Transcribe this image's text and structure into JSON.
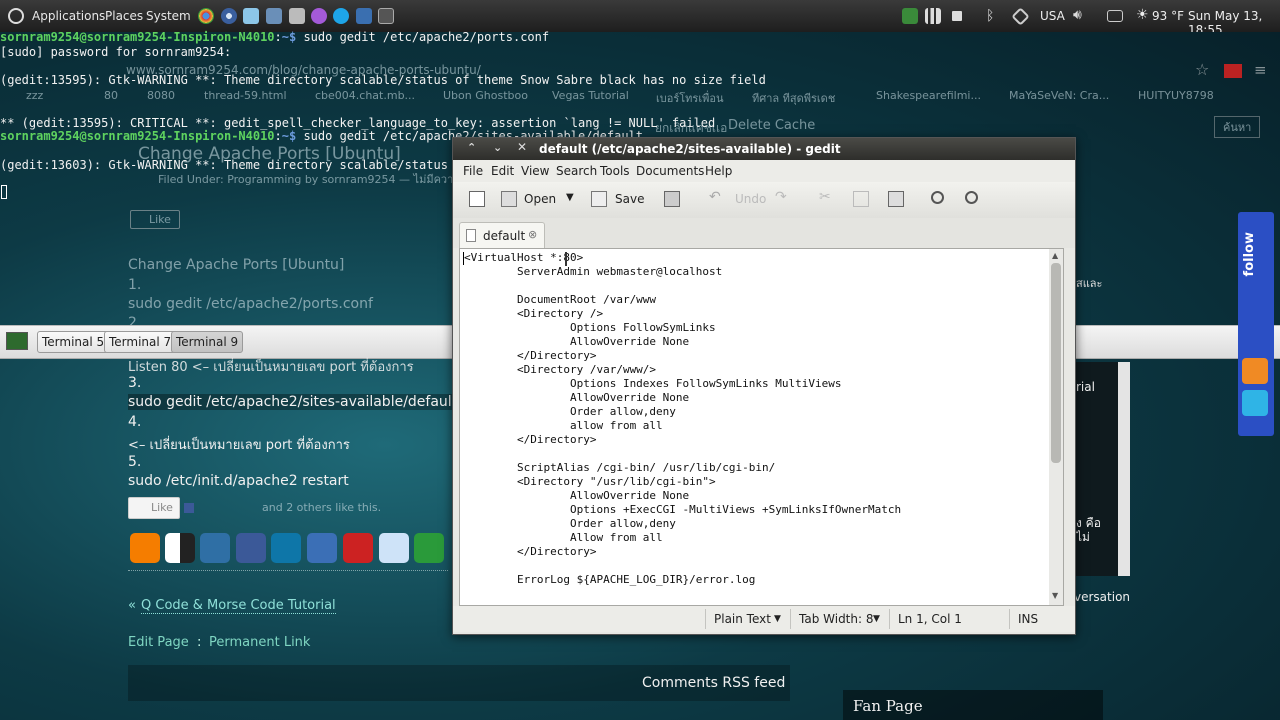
{
  "top_panel": {
    "menus": [
      "Applications",
      "Places",
      "System"
    ],
    "keyboard_layout": "USA",
    "temperature": "93 °F",
    "clock": "Sun May 13, 18:55"
  },
  "terminal": {
    "lines": [
      {
        "user": "sornram9254@sornram9254-Inspiron-N4010",
        "path": "~$",
        "cmd": " sudo gedit /etc/apache2/ports.conf"
      },
      {
        "text": "[sudo] password for sornram9254:"
      },
      {
        "text": ""
      },
      {
        "text": "(gedit:13595): Gtk-WARNING **: Theme directory scalable/status of theme Snow Sabre black has no size field"
      },
      {
        "text": ""
      },
      {
        "text": ""
      },
      {
        "text": "** (gedit:13595): CRITICAL **: gedit_spell_checker_language_to_key: assertion `lang != NULL' failed"
      },
      {
        "user": "sornram9254@sornram9254-Inspiron-N4010",
        "path": "~$",
        "cmd": " sudo gedit /etc/apache2/sites-available/default"
      },
      {
        "text": ""
      },
      {
        "text": "(gedit:13603): Gtk-WARNING **: Theme directory scalable/status of the"
      }
    ]
  },
  "browser_ghost": {
    "url": "www.sornram9254.com/blog/change-apache-ports-ubuntu/",
    "bookmarks": [
      "zzz",
      "80",
      "8080",
      "thread-59.html",
      "cbe004.chat.mb...",
      "Ubon Ghostboo",
      "Vegas Tutorial",
      "เบอร์โทรเพื่อน",
      "ทีศาล ทีสุดพีรเดช",
      "Shakespearefilmi...",
      "MaYaSeVeN: Cra...",
      "HUITYUY8798"
    ],
    "toolbar_ghost": [
      "ยกเลิกแคชเเอ",
      "Delete Cache",
      "ค้นหา"
    ],
    "post_title": "Change Apache Ports [Ubuntu]",
    "post_meta": "Filed Under: Programming by sornram9254 — ไม่มีความเห็น",
    "like_label": "Like",
    "steps_heading": "Change Apache Ports [Ubuntu]",
    "step1_num": "1.",
    "step1_cmd": "sudo gedit /etc/apache2/ports.conf",
    "step2_num": "2.",
    "step2_text": "Listen 80 <– เปลี่ยนเป็นหมายเลข port ที่ต้องการ",
    "step3_num": "3.",
    "step3_cmd": "sudo gedit /etc/apache2/sites-available/default",
    "step4_num": "4.",
    "step4_text": "<– เปลี่ยนเป็นหมายเลข port ที่ต้องการ",
    "step5_num": "5.",
    "step5_cmd": "sudo /etc/init.d/apache2 restart",
    "like2_label": "Like",
    "like_friends": "and 2 others like this.",
    "prev_link": "Q Code & Morse Code Tutorial",
    "prev_prefix": "«",
    "edit_page": "Edit Page",
    "separator": ":",
    "permanent_link": "Permanent Link",
    "comments_rss": "Comments RSS feed",
    "fan_page": "Fan Page",
    "side_texts": [
      "rial",
      "ง คือ",
      "ไม่",
      "versation",
      "สและ"
    ],
    "follow_label": "follow"
  },
  "taskbar": {
    "buttons": [
      "Terminal 5",
      "Terminal 7",
      "Terminal 9"
    ]
  },
  "gedit": {
    "title": "default (/etc/apache2/sites-available) - gedit",
    "menus": [
      "File",
      "Edit",
      "View",
      "Search",
      "Tools",
      "Documents",
      "Help"
    ],
    "toolbar": {
      "open": "Open",
      "save": "Save",
      "undo": "Undo"
    },
    "tab_name": "default",
    "code": [
      "<VirtualHost *:80>",
      "        ServerAdmin webmaster@localhost",
      "",
      "        DocumentRoot /var/www",
      "        <Directory />",
      "                Options FollowSymLinks",
      "                AllowOverride None",
      "        </Directory>",
      "        <Directory /var/www/>",
      "                Options Indexes FollowSymLinks MultiViews",
      "                AllowOverride None",
      "                Order allow,deny",
      "                allow from all",
      "        </Directory>",
      "",
      "        ScriptAlias /cgi-bin/ /usr/lib/cgi-bin/",
      "        <Directory \"/usr/lib/cgi-bin\">",
      "                AllowOverride None",
      "                Options +ExecCGI -MultiViews +SymLinksIfOwnerMatch",
      "                Order allow,deny",
      "                Allow from all",
      "        </Directory>",
      "",
      "        ErrorLog ${APACHE_LOG_DIR}/error.log"
    ],
    "status": {
      "language": "Plain Text",
      "tab_width": "Tab Width:  8",
      "position": "Ln 1, Col 1",
      "mode": "INS"
    }
  },
  "colors": {
    "prompt_user": "#5fd35f",
    "prompt_path": "#6c9bdc",
    "link": "#8fe0d8",
    "panel": "#2a2a2a"
  }
}
